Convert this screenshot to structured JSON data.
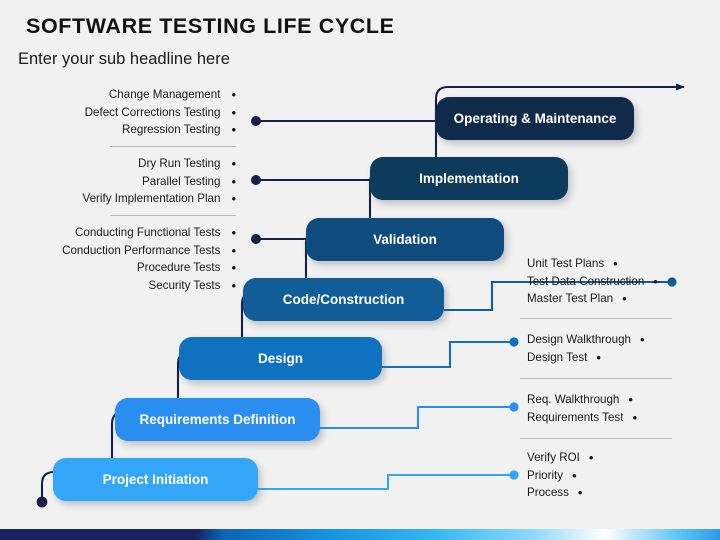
{
  "header": {
    "title": "SOFTWARE TESTING LIFE CYCLE",
    "subtitle": "Enter your sub headline here"
  },
  "colors": {
    "background": "#f1f1f1",
    "stage_operating": "#102a4c",
    "stage_implementation": "#0d3b5c",
    "stage_validation": "#104b7d",
    "stage_code": "#125c97",
    "stage_design": "#0f72c0",
    "stage_requirements": "#2a8ef0",
    "stage_initiation": "#33a6f7",
    "staircase_line": "#16204a",
    "text_dark": "#1a1a1a",
    "divider": "#b8b8b8"
  },
  "stages": [
    {
      "id": "operating",
      "label": "Operating & Maintenance"
    },
    {
      "id": "implementation",
      "label": "Implementation"
    },
    {
      "id": "validation",
      "label": "Validation"
    },
    {
      "id": "code",
      "label": "Code/Construction"
    },
    {
      "id": "design",
      "label": "Design"
    },
    {
      "id": "requirements",
      "label": "Requirements Definition"
    },
    {
      "id": "initiation",
      "label": "Project Initiation"
    }
  ],
  "left_notes": [
    {
      "id": "operating-notes",
      "items": [
        "Change Management",
        "Defect Corrections Testing",
        "Regression Testing"
      ]
    },
    {
      "id": "implementation-notes",
      "items": [
        "Dry Run Testing",
        "Parallel Testing",
        "Verify Implementation Plan"
      ]
    },
    {
      "id": "validation-notes",
      "items": [
        "Conducting Functional Tests",
        "Conduction Performance Tests",
        "Procedure Tests",
        "Security Tests"
      ]
    }
  ],
  "right_notes": [
    {
      "id": "code-notes",
      "items": [
        "Unit Test Plans",
        "Test Data Construction",
        "Master Test Plan"
      ]
    },
    {
      "id": "design-notes",
      "items": [
        "Design Walkthrough",
        "Design Test"
      ]
    },
    {
      "id": "requirements-notes",
      "items": [
        "Req. Walkthrough",
        "Requirements Test"
      ]
    },
    {
      "id": "initiation-notes",
      "items": [
        "Verify ROI",
        "Priority",
        "Process"
      ]
    }
  ],
  "bullet_glyph": "•"
}
